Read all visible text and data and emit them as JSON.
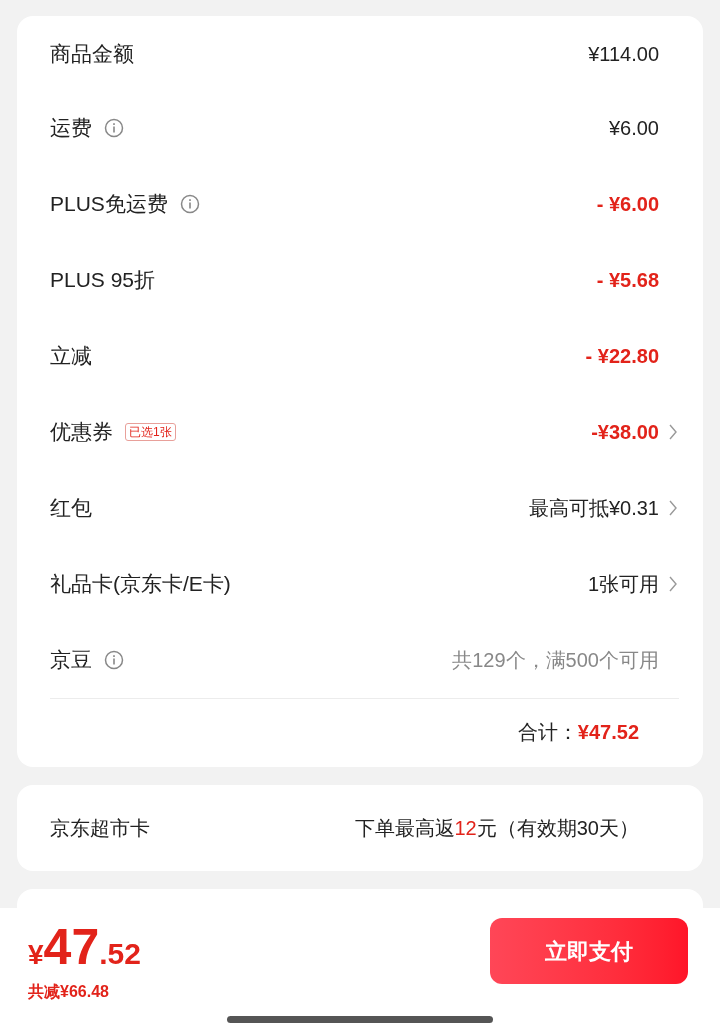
{
  "summary": {
    "rows": [
      {
        "label": "商品金额",
        "info": false,
        "value": "¥114.00",
        "kind": "normal",
        "chevron": false
      },
      {
        "label": "运费",
        "info": true,
        "value": "¥6.00",
        "kind": "normal",
        "chevron": false
      },
      {
        "label": "PLUS免运费",
        "info": true,
        "value": "- ¥6.00",
        "kind": "discount",
        "chevron": false
      },
      {
        "label": "PLUS 95折",
        "info": false,
        "value": "- ¥5.68",
        "kind": "discount",
        "chevron": false
      },
      {
        "label": "立减",
        "info": false,
        "value": "- ¥22.80",
        "kind": "discount",
        "chevron": false
      },
      {
        "label": "优惠券",
        "info": false,
        "tag": "已选1张",
        "value": "-¥38.00",
        "kind": "discount",
        "chevron": true
      },
      {
        "label": "红包",
        "info": false,
        "value": "最高可抵¥0.31",
        "kind": "normal",
        "chevron": true
      },
      {
        "label": "礼品卡(京东卡/E卡)",
        "info": false,
        "value": "1张可用",
        "kind": "normal",
        "chevron": true
      },
      {
        "label": "京豆",
        "info": true,
        "value": "共129个，满500个可用",
        "kind": "muted",
        "chevron": false
      }
    ],
    "total": {
      "label": "合计：",
      "amount": "¥47.52"
    }
  },
  "supermarket_card": {
    "label": "京东超市卡",
    "parts": [
      {
        "text": "下单最高返",
        "highlight": false
      },
      {
        "text": "12",
        "highlight": true
      },
      {
        "text": "元（有效期30天）",
        "highlight": false
      }
    ]
  },
  "bottom_bar": {
    "currency": "¥",
    "integer": "47",
    "decimal": ".52",
    "saving": "共减¥66.48",
    "pay_button": "立即支付"
  }
}
